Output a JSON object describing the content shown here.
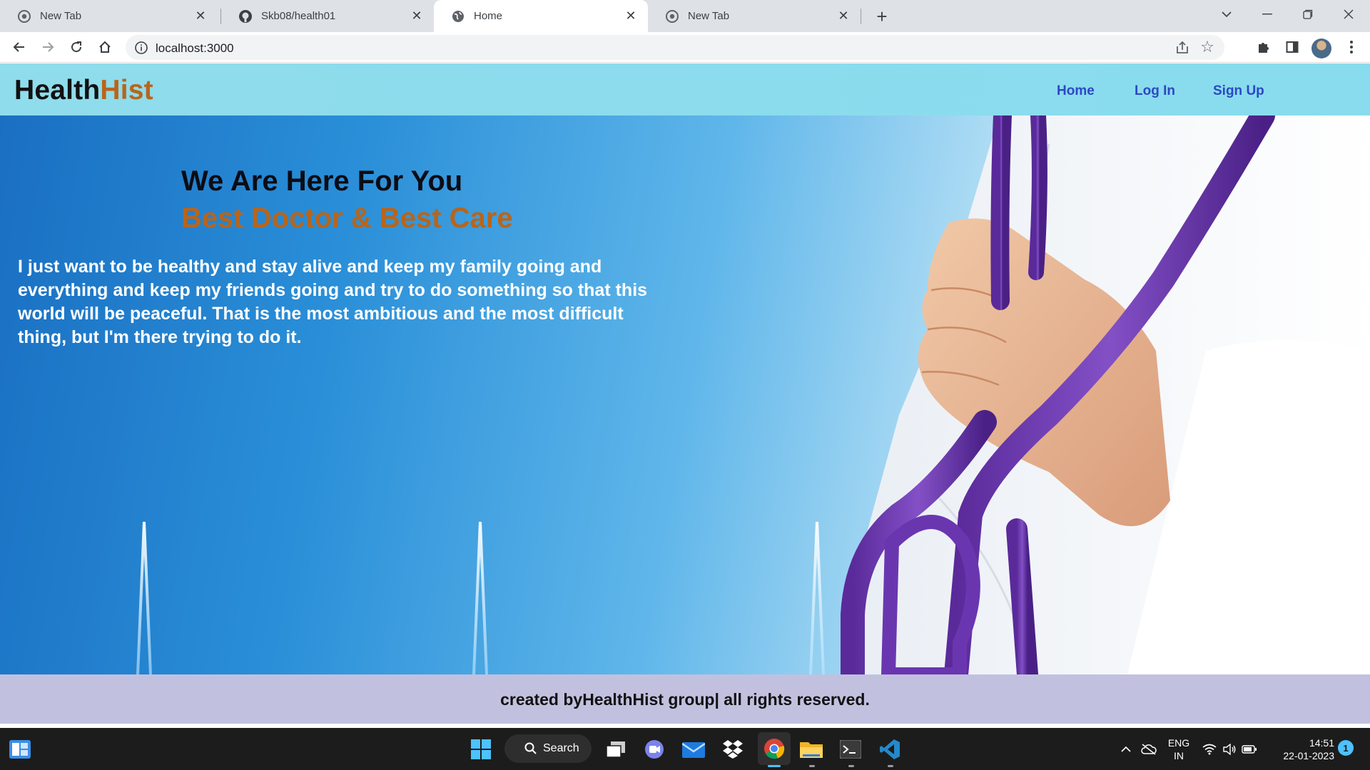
{
  "browser": {
    "tabs": [
      {
        "label": "New Tab",
        "icon": "chrome-icon",
        "active": false
      },
      {
        "label": "Skb08/health01",
        "icon": "github-icon",
        "active": false
      },
      {
        "label": "Home",
        "icon": "globe-icon",
        "active": true
      },
      {
        "label": "New Tab",
        "icon": "chrome-icon",
        "active": false
      }
    ],
    "new_tab_symbol": "+",
    "close_symbol": "✕",
    "address": "localhost:3000"
  },
  "site": {
    "logo_main": "Health",
    "logo_accent": "Hist",
    "nav": {
      "home": "Home",
      "login": "Log In",
      "signup": "Sign Up"
    },
    "hero": {
      "title": "We Are Here For You",
      "subtitle": "Best Doctor & Best Care",
      "quote": "I just want to be healthy and stay alive and keep my family going and everything and keep my friends going and try to do something so that this world will be peaceful. That is the most ambitious and the most difficult thing, but I'm there trying to do it."
    },
    "footer": "created byHealthHist group| all rights reserved.",
    "colors": {
      "header_bg": "#8fdcec",
      "logo_accent": "#b8651b",
      "nav_link": "#2c48c4",
      "footer_bg": "#c1c1df"
    }
  },
  "taskbar": {
    "search_label": "Search",
    "apps": [
      "start-icon",
      "search",
      "task-view-icon",
      "teams-icon",
      "mail-icon",
      "dropbox-icon",
      "chrome-icon",
      "file-explorer-icon",
      "terminal-icon",
      "vscode-icon"
    ],
    "lang_top": "ENG",
    "lang_bottom": "IN",
    "time": "14:51",
    "date": "22-01-2023",
    "notification_count": "1"
  }
}
